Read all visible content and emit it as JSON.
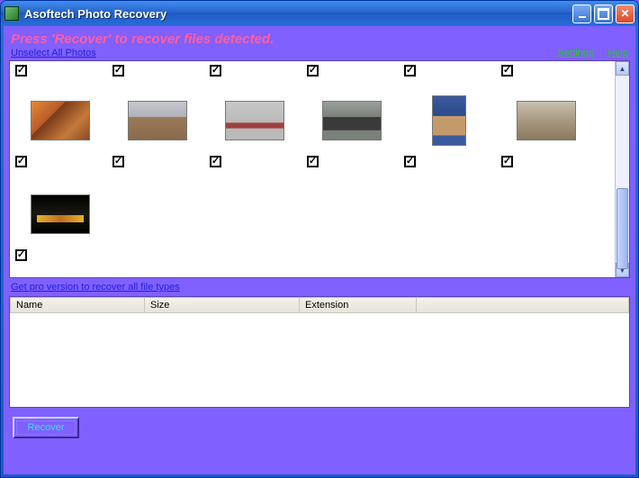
{
  "window": {
    "title": "Asoftech Photo Recovery"
  },
  "instruction": "Press 'Recover' to recover files detected.",
  "links": {
    "unselect": "Unselect All Photos",
    "settings": "Settings",
    "help": "Help",
    "pro": "Get pro version to recover all file types"
  },
  "thumbs": {
    "row0": [
      {
        "checked": true
      },
      {
        "checked": true
      },
      {
        "checked": true
      },
      {
        "checked": true
      },
      {
        "checked": true
      },
      {
        "checked": true
      }
    ],
    "row1": [
      {
        "checked": true
      },
      {
        "checked": true
      },
      {
        "checked": true
      },
      {
        "checked": true
      },
      {
        "checked": true
      },
      {
        "checked": true
      }
    ],
    "row2": [
      {
        "checked": true
      }
    ]
  },
  "table": {
    "headers": {
      "name": "Name",
      "size": "Size",
      "extension": "Extension"
    }
  },
  "buttons": {
    "recover": "Recover"
  }
}
